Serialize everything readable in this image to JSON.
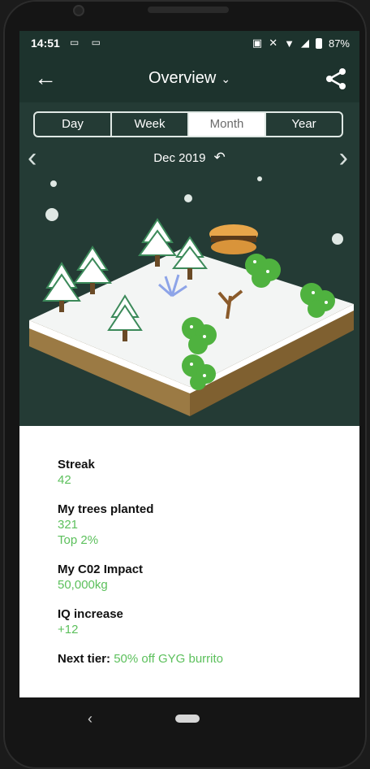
{
  "status_bar": {
    "time": "14:51",
    "left_icons": [
      "video-camera-icon",
      "video-camera-icon"
    ],
    "right_icons": [
      "cast-icon",
      "mute-icon",
      "wifi-icon",
      "signal-icon",
      "battery-icon"
    ],
    "battery": "87%"
  },
  "app_bar": {
    "title": "Overview",
    "title_chevron": "⌄",
    "back_icon": "back-arrow-icon",
    "share_icon": "share-icon"
  },
  "tabs": [
    {
      "label": "Day",
      "active": false
    },
    {
      "label": "Week",
      "active": false
    },
    {
      "label": "Month",
      "active": true
    },
    {
      "label": "Year",
      "active": false
    }
  ],
  "date_nav": {
    "date": "Dec 2019",
    "prev_icon": "chevron-left-icon",
    "next_icon": "chevron-right-icon",
    "reset_icon": "undo-icon"
  },
  "stats": {
    "streak": {
      "label": "Streak",
      "value": "42"
    },
    "trees": {
      "label": "My trees planted",
      "value": "321",
      "rank": "Top 2%"
    },
    "co2": {
      "label": "My C02 Impact",
      "value": "50,000kg"
    },
    "iq": {
      "label": "IQ increase",
      "value": "+12"
    },
    "tier": {
      "label": "Next tier:",
      "value": "50% off GYG burrito"
    }
  },
  "colors": {
    "background": "#243b35",
    "appbar": "#1d332d",
    "accent_green": "#5cc05c",
    "card": "#ffffff"
  }
}
